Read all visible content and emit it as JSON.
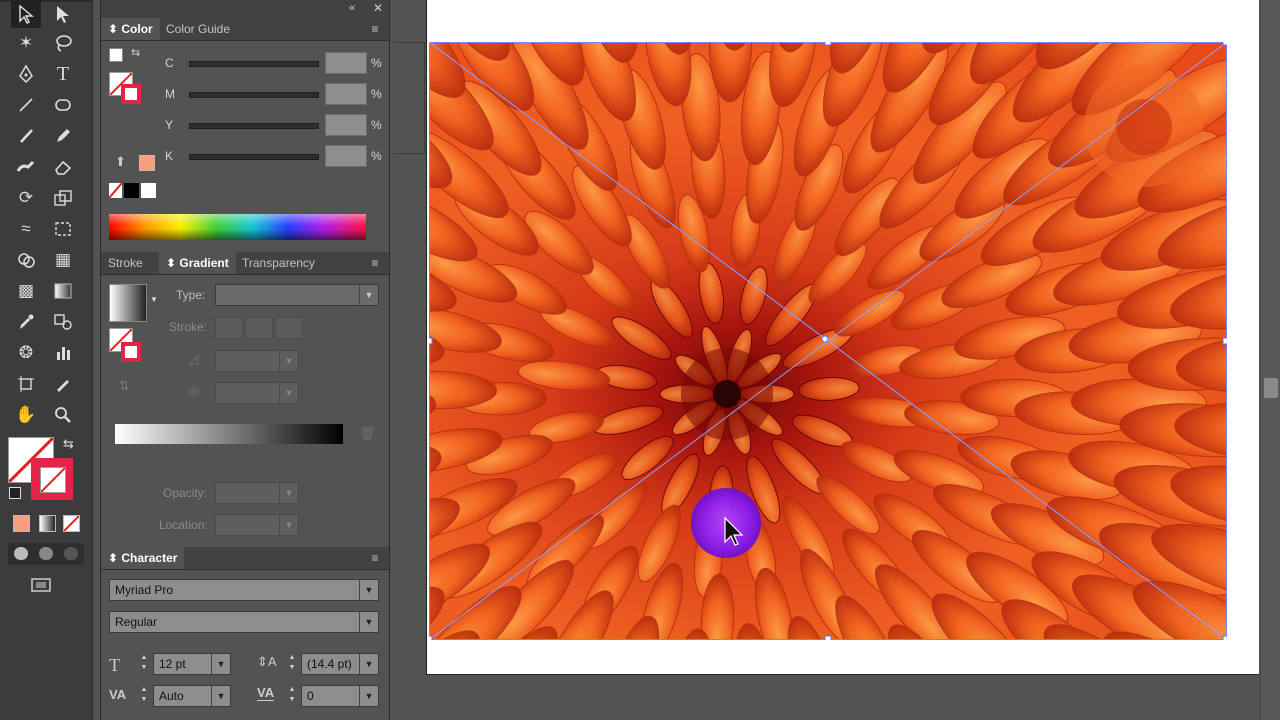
{
  "color_panel": {
    "tabs": [
      "Color",
      "Color Guide"
    ],
    "rows": [
      {
        "label": "C",
        "unit": "%"
      },
      {
        "label": "M",
        "unit": "%"
      },
      {
        "label": "Y",
        "unit": "%"
      },
      {
        "label": "K",
        "unit": "%"
      }
    ],
    "swatch_color": "#f4a07a"
  },
  "gradient_panel": {
    "tabs": [
      "Stroke",
      "Gradient",
      "Transparency"
    ],
    "type_label": "Type:",
    "stroke_label": "Stroke:",
    "opacity_label": "Opacity:",
    "location_label": "Location:"
  },
  "character_panel": {
    "title": "Character",
    "font_family": "Myriad Pro",
    "font_style": "Regular",
    "font_size": "12 pt",
    "leading": "(14.4 pt)",
    "kerning": "Auto",
    "tracking": "0"
  },
  "colors": {
    "panel_bg": "#535353",
    "toolbar_bg": "#3c3c3c",
    "selection_blue": "#6f86ff",
    "flower_orange": "#e2461b",
    "cursor_highlight": "#8a1cf0"
  },
  "icons": [
    "selection-tool",
    "direct-selection-tool",
    "magic-wand-tool",
    "lasso-tool",
    "pen-tool",
    "type-tool",
    "line-tool",
    "ellipse-tool",
    "paintbrush-tool",
    "pencil-tool",
    "blob-brush-tool",
    "eraser-tool",
    "rotate-tool",
    "scale-tool",
    "width-tool",
    "free-transform-tool",
    "shape-builder-tool",
    "perspective-grid-tool",
    "mesh-tool",
    "gradient-tool",
    "eyedropper-tool",
    "blend-tool",
    "symbol-sprayer-tool",
    "column-graph-tool",
    "artboard-tool",
    "slice-tool",
    "hand-tool",
    "zoom-tool"
  ]
}
